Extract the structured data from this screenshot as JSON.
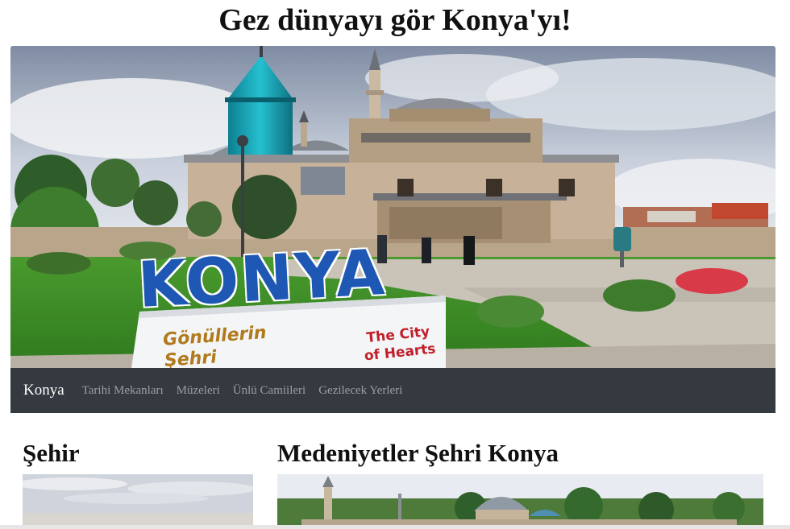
{
  "header": {
    "title": "Gez dünyayı gör Konya'yı!"
  },
  "hero": {
    "sign_word": "KONYA",
    "sign_tagline_left": "Gönüllerin Şehri",
    "sign_tagline_right": "The City of Hearts"
  },
  "navbar": {
    "brand": "Konya",
    "links": [
      "Tarihi Mekanları",
      "Müzeleri",
      "Ünlü Camiileri",
      "Gezilecek Yerleri"
    ]
  },
  "sections": {
    "left_title": "Şehir",
    "right_title": "Medeniyetler Şehri Konya"
  },
  "colors": {
    "navbar_bg": "#343a40",
    "nav_link": "#9a9fa4",
    "brand_text": "#ffffff",
    "dome_turquoise": "#1aa6b8"
  }
}
